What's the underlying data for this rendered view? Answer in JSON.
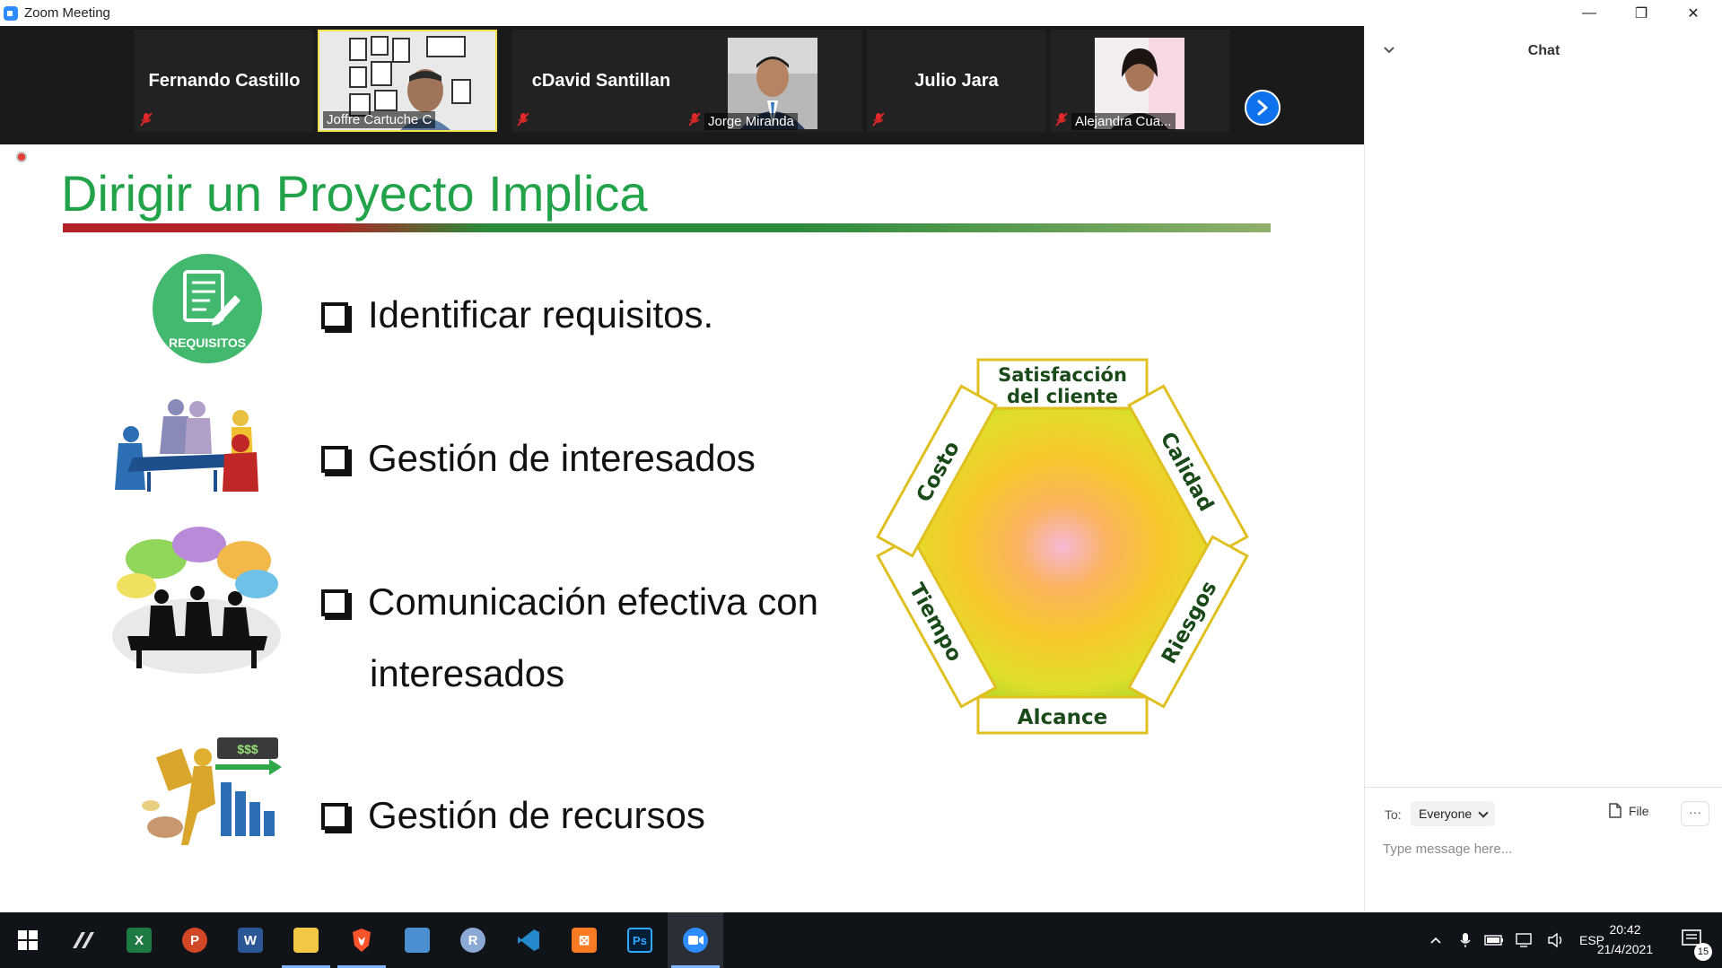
{
  "window": {
    "title": "Zoom Meeting",
    "controls": {
      "minimize": "—",
      "restore": "❐",
      "close": "✕"
    }
  },
  "gallery": {
    "participants": [
      {
        "name": "Fernando Castillo",
        "video": false,
        "muted": true
      },
      {
        "name": "Joffre Cartuche C",
        "video": true,
        "muted": false,
        "active_speaker": true
      },
      {
        "name": "cDavid Santillan",
        "video": false,
        "muted": true
      },
      {
        "name": "Jorge Miranda",
        "video": true,
        "muted": true
      },
      {
        "name": "Julio Jara",
        "video": false,
        "muted": true
      },
      {
        "name": "Alejandra Cua...",
        "video": true,
        "muted": true
      }
    ]
  },
  "slide": {
    "title": "Dirigir un Proyecto Implica",
    "bullets": [
      "Identificar requisitos.",
      "Gestión de interesados",
      "Comunicación efectiva con",
      "interesados",
      "Gestión de recursos"
    ],
    "requisitos_badge": "REQUISITOS",
    "hexagon": {
      "top_line1": "Satisfacción",
      "top_line2": "del cliente",
      "top_right": "Calidad",
      "bottom_right": "Riesgos",
      "bottom": "Alcance",
      "bottom_left": "Tiempo",
      "top_left": "Costo"
    }
  },
  "chat": {
    "title": "Chat",
    "to_label": "To:",
    "recipient": "Everyone",
    "file_label": "File",
    "more_label": "···",
    "input_placeholder": "Type message here..."
  },
  "taskbar": {
    "apps": [
      "windows-start",
      "stylus-app",
      "excel",
      "powerpoint",
      "word",
      "file-explorer",
      "brave",
      "control-panel",
      "r-app",
      "vscode",
      "xampp",
      "photoshop",
      "zoom"
    ],
    "tray": {
      "language": "ESP",
      "time": "20:42",
      "date": "21/4/2021",
      "notifications": "15"
    }
  }
}
